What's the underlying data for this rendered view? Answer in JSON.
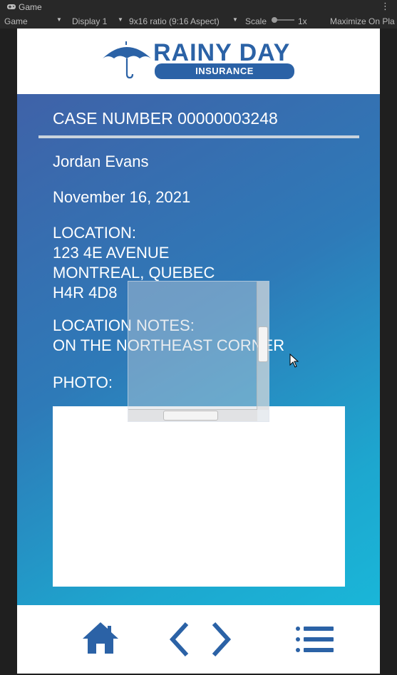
{
  "editor": {
    "tab_title": "Game",
    "tab_icon": "gamepad-icon",
    "tab_menu_glyph": "⋮",
    "toolbar": {
      "game_label": "Game",
      "display_label": "Display 1",
      "aspect_label": "9x16 ratio (9:16 Aspect)",
      "scale_label": "Scale",
      "scale_value": "1x",
      "maximize_label": "Maximize On Pla"
    }
  },
  "app": {
    "logo": {
      "title": "RAINY DAY",
      "subtitle": "INSURANCE",
      "icon": "umbrella-icon"
    },
    "case_number": "CASE NUMBER 00000003248",
    "claimant_name": "Jordan Evans",
    "date": "November 16, 2021",
    "location_label": "LOCATION:",
    "address_line1": "123 4E AVENUE",
    "address_line2": "MONTREAL, QUEBEC",
    "address_line3": "H4R 4D8",
    "location_notes_label": "LOCATION NOTES:",
    "location_notes": "ON THE NORTHEAST CORNER",
    "photo_label": "PHOTO:",
    "footer": {
      "home_icon": "home-icon",
      "prev_icon": "chevron-left-icon",
      "next_icon": "chevron-right-icon",
      "menu_icon": "list-menu-icon"
    }
  },
  "colors": {
    "brand_blue": "#2b62a6",
    "panel_gradient_start": "#3f62a8",
    "panel_gradient_end": "#1ab6d8",
    "editor_bg": "#282828"
  }
}
